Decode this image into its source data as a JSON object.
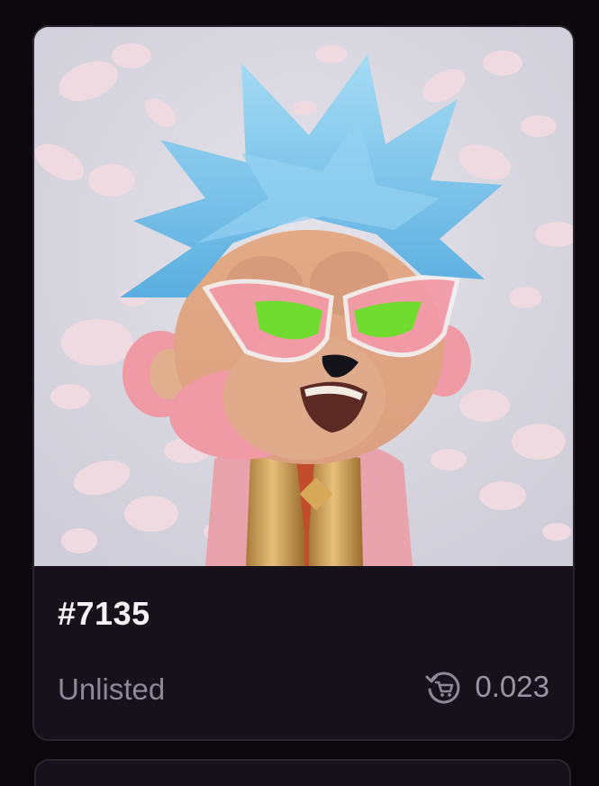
{
  "card": {
    "title": "#7135",
    "status": "Unlisted",
    "price": "0.023",
    "price_icon": "cart-refresh-icon"
  },
  "colors": {
    "background": "#0b070d",
    "card_background": "#17111b",
    "card_border": "#2b2430",
    "title_text": "#f6f3f8",
    "muted_text": "#8e8796",
    "art_background": "#d4d2db",
    "hair": "#7cc4ea",
    "face": "#e7b18f",
    "ears": "#f0a8b3",
    "glasses_lens": "#f39aa8",
    "eyes": "#7ce73a",
    "vest": "#c9964a",
    "petals": "#f1dbe2"
  }
}
